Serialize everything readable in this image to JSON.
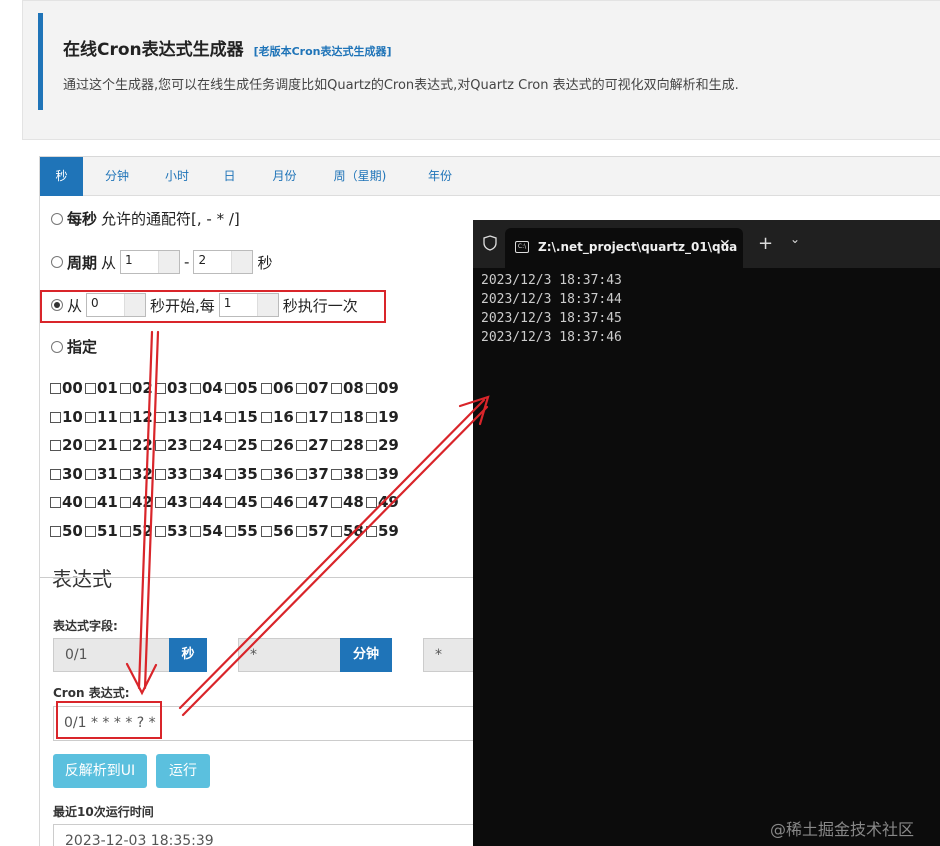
{
  "header": {
    "title": "在线Cron表达式生成器",
    "old_version_link": "[老版本Cron表达式生成器]",
    "description": "通过这个生成器,您可以在线生成任务调度比如Quartz的Cron表达式,对Quartz Cron 表达式的可视化双向解析和生成."
  },
  "tabs": [
    "秒",
    "分钟",
    "小时",
    "日",
    "月份",
    "周（星期)",
    "年份"
  ],
  "options": {
    "every": {
      "label": "每秒",
      "note": "允许的通配符[, - * /]"
    },
    "period": {
      "label": "周期",
      "from": "从",
      "start": "1",
      "dash": "-",
      "end": "2",
      "unit": "秒"
    },
    "from": {
      "label": "从",
      "start": "0",
      "mid": "秒开始,每",
      "step": "1",
      "tail": "秒执行一次"
    },
    "specify": {
      "label": "指定"
    }
  },
  "seconds": [
    "00",
    "01",
    "02",
    "03",
    "04",
    "05",
    "06",
    "07",
    "08",
    "09",
    "10",
    "11",
    "12",
    "13",
    "14",
    "15",
    "16",
    "17",
    "18",
    "19",
    "20",
    "21",
    "22",
    "23",
    "24",
    "25",
    "26",
    "27",
    "28",
    "29",
    "30",
    "31",
    "32",
    "33",
    "34",
    "35",
    "36",
    "37",
    "38",
    "39",
    "40",
    "41",
    "42",
    "43",
    "44",
    "45",
    "46",
    "47",
    "48",
    "49",
    "50",
    "51",
    "52",
    "53",
    "54",
    "55",
    "56",
    "57",
    "58",
    "59"
  ],
  "expression": {
    "legend": "表达式",
    "fields_label": "表达式字段:",
    "second_value": "0/1",
    "second_addon": "秒",
    "minute_value": "*",
    "minute_addon": "分钟",
    "hour_value": "*",
    "cron_label": "Cron 表达式:",
    "cron_value": "0/1 * * * * ? *",
    "reverse_button": "反解析到UI",
    "run_button": "运行",
    "recent_label": "最近10次运行时间",
    "recent_first": "2023-12-03 18:35:39"
  },
  "terminal": {
    "tab_title": "Z:\\.net_project\\quartz_01\\qua",
    "close": "✕",
    "new_tab": "+",
    "dropdown": "⌄",
    "lines": [
      "2023/12/3 18:37:43",
      "2023/12/3 18:37:44",
      "2023/12/3 18:37:45",
      "2023/12/3 18:37:46"
    ]
  },
  "watermark": "@稀土掘金技术社区",
  "colors": {
    "accent": "#1f74b8",
    "annotation": "#d9252a",
    "info_button": "#5bc0de",
    "terminal_bg": "#0c0c0c"
  }
}
